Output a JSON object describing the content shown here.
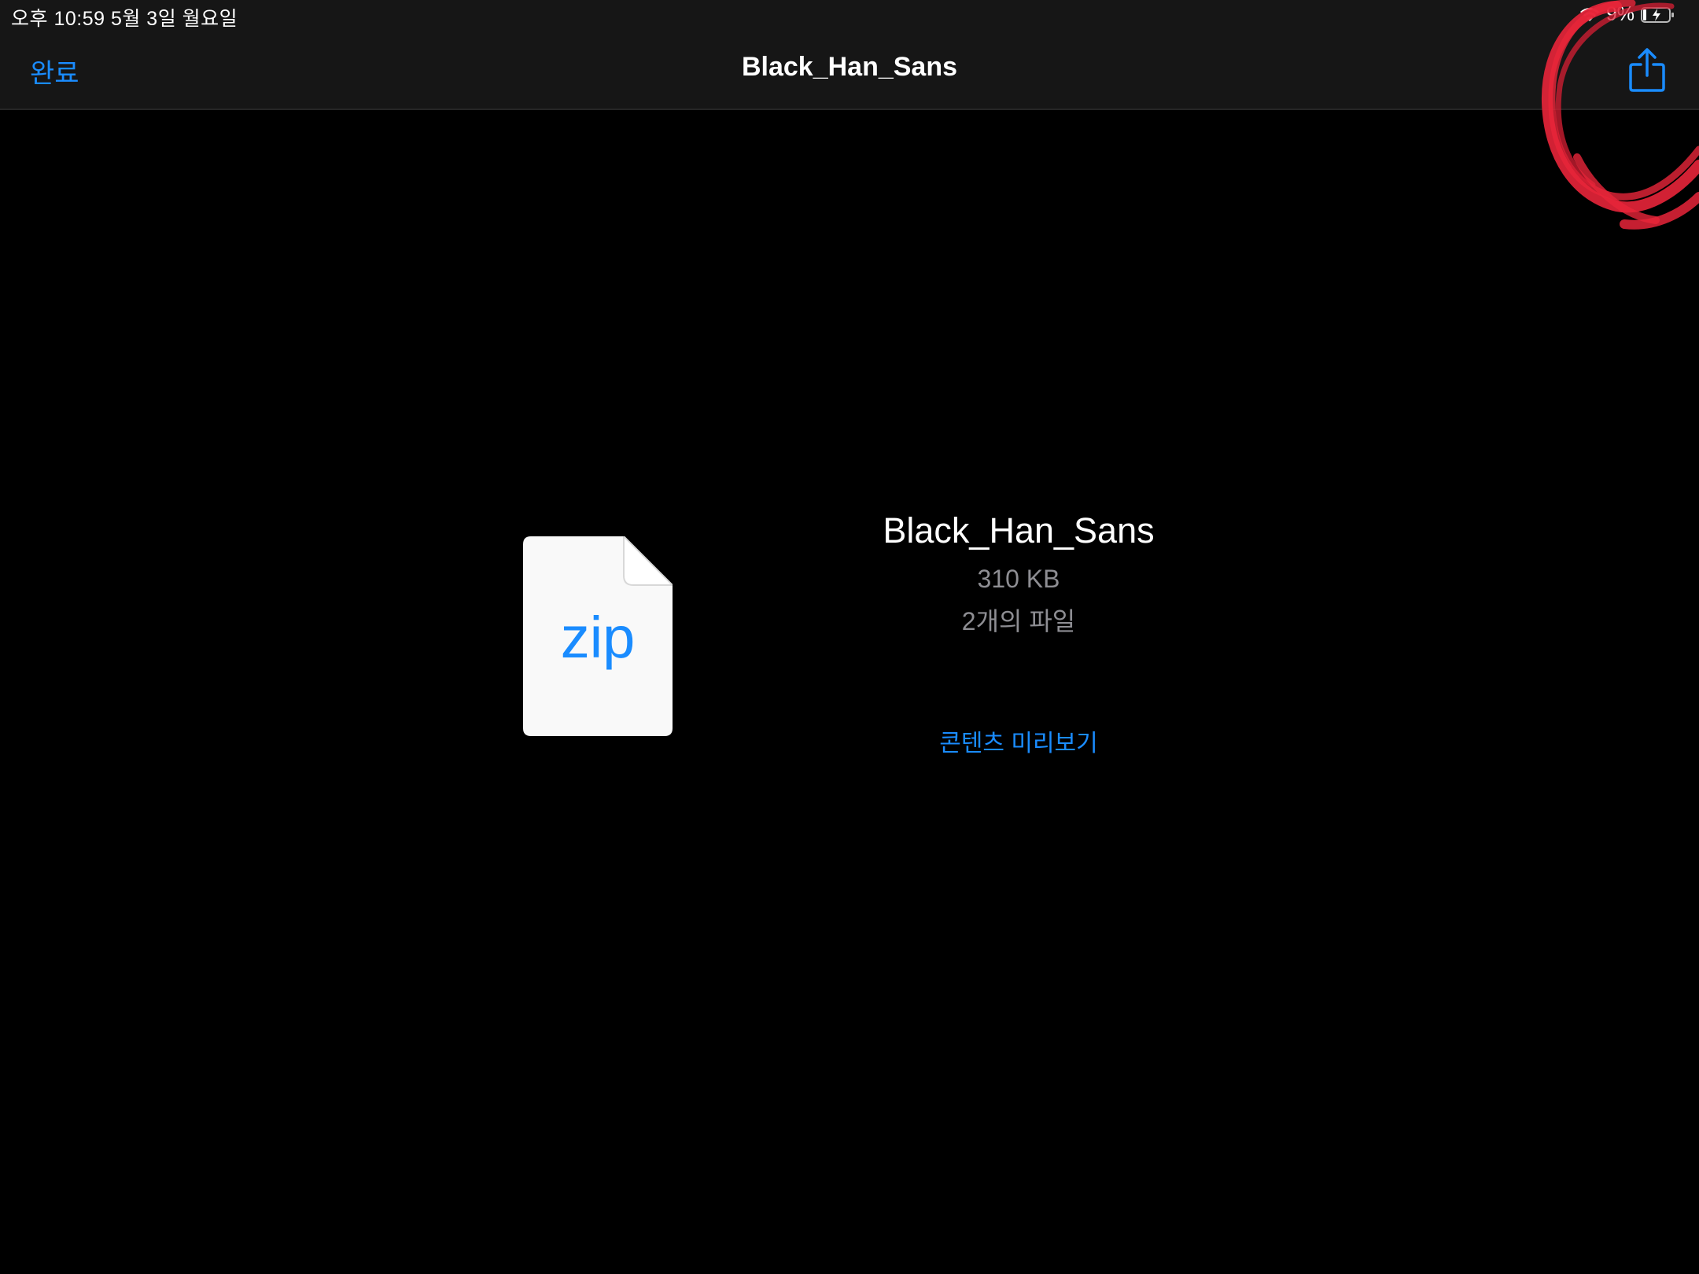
{
  "status_bar": {
    "time_date": "오후 10:59   5월 3일 월요일",
    "battery_percent": "9%",
    "wifi_icon": "wifi-icon",
    "battery_icon": "battery-charging-icon"
  },
  "nav_bar": {
    "done_label": "완료",
    "title": "Black_Han_Sans",
    "share_icon": "share-icon"
  },
  "file": {
    "icon_label": "zip",
    "name": "Black_Han_Sans",
    "size": "310 KB",
    "count": "2개의 파일",
    "preview_label": "콘텐츠 미리보기"
  },
  "colors": {
    "accent": "#1a8cff",
    "background": "#000000",
    "bar_background": "#161616",
    "secondary_text": "#8e8e93",
    "annotation": "#e8253a"
  }
}
